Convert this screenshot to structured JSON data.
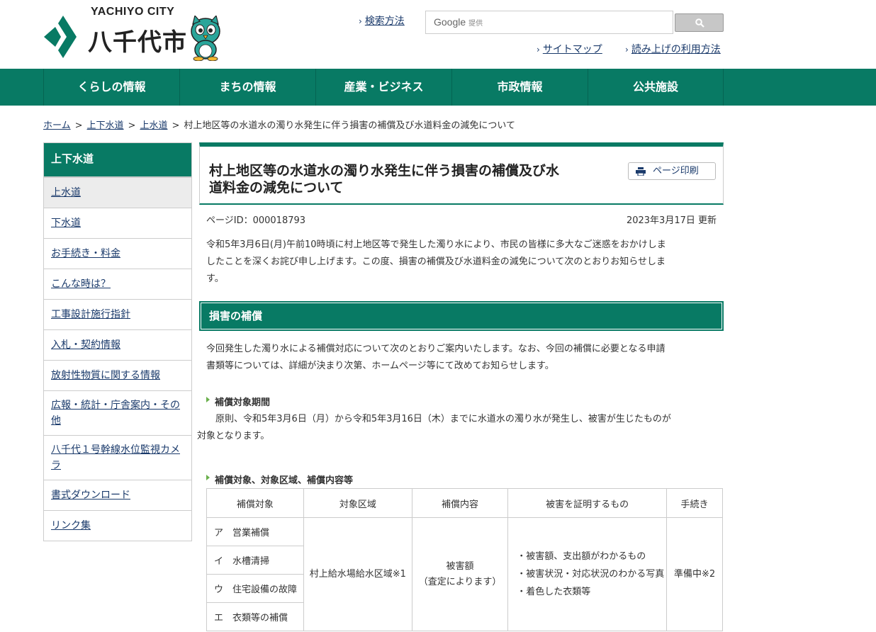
{
  "header": {
    "logo_en": "YACHIYO CITY",
    "logo_jp": "八千代市",
    "search_method_link": "検索方法",
    "search_placeholder_brand": "Google",
    "search_placeholder_suffix": "提供",
    "sitemap_link": "サイトマップ",
    "readaloud_link": "読み上げの利用方法"
  },
  "nav": {
    "items": [
      "くらしの情報",
      "まちの情報",
      "産業・ビジネス",
      "市政情報",
      "公共施設"
    ]
  },
  "breadcrumb": {
    "items": [
      "ホーム",
      "上下水道",
      "上水道"
    ],
    "current": "村上地区等の水道水の濁り水発生に伴う損害の補償及び水道料金の減免について"
  },
  "sidebar": {
    "heading": "上下水道",
    "items": [
      "上水道",
      "下水道",
      "お手続き・料金",
      "こんな時は？",
      "工事設計施行指針",
      "入札・契約情報",
      "放射性物質に関する情報",
      "広報・統計・庁舎案内・その他",
      "八千代１号幹線水位監視カメラ",
      "書式ダウンロード",
      "リンク集"
    ]
  },
  "main": {
    "title_line1": "村上地区等の水道水の濁り水発生に伴う損害の補償及び水",
    "title_line2": "道料金の減免について",
    "print_label": "ページ印刷",
    "page_id": "ページID：000018793",
    "updated": "2023年3月17日 更新",
    "lead_lines": [
      "令和5年3月6日(月)午前10時頃に村上地区等で発生した濁り水により、市民の皆様に多大なご迷惑をおかけしま",
      "したことを深くお詫び申し上げます。この度、損害の補償及び水道料金の減免について次のとおりお知らせしま",
      "す。"
    ],
    "section_heading": "損害の補償",
    "section_lines": [
      "今回発生した濁り水による補償対応について次のとおりご案内いたします。なお、今回の補償に必要となる申請",
      "書類等については、詳細が決まり次第、ホームページ等にて改めてお知らせします。"
    ],
    "period_heading": "補償対象期間",
    "period_lines": [
      "原則、令和5年3月6日（月）から令和5年3月16日（木）までに水道水の濁り水が発生し、被害が生じたものが",
      "対象となります。"
    ],
    "table_heading": "補償対象、対象区域、補償内容等",
    "table": {
      "headers": [
        "補償対象",
        "対象区域",
        "補償内容",
        "被害を証明するもの",
        "手続き"
      ],
      "targets": [
        "ア　営業補償",
        "イ　水槽清掃",
        "ウ　住宅設備の故障",
        "エ　衣類等の補償"
      ],
      "area": "村上給水場給水区域※1",
      "content_line1": "被害額",
      "content_line2": "（査定によります）",
      "proofs": [
        "・被害額、支出額がわかるもの",
        "・被害状況・対応状況のわかる写真",
        "・着色した衣類等"
      ],
      "procedure": "準備中※2"
    }
  }
}
